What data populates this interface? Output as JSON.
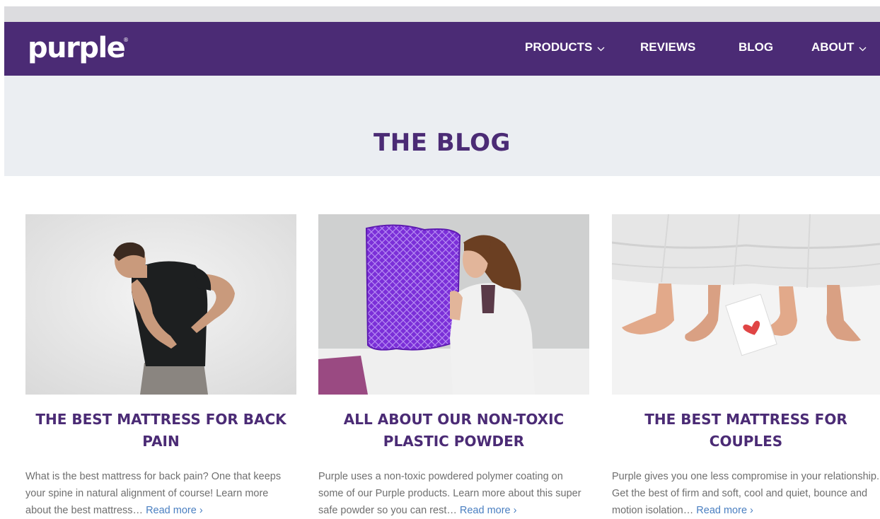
{
  "header": {
    "logo_text": "purple",
    "logo_mark": "®",
    "nav": [
      {
        "label": "PRODUCTS",
        "dropdown": true
      },
      {
        "label": "REVIEWS",
        "dropdown": false
      },
      {
        "label": "BLOG",
        "dropdown": false
      },
      {
        "label": "ABOUT",
        "dropdown": true
      }
    ]
  },
  "hero": {
    "title": "THE BLOG"
  },
  "posts": [
    {
      "title": "THE BEST MATTRESS FOR BACK PAIN",
      "excerpt": "What is the best mattress for back pain? One that keeps your spine in natural alignment of course! Learn more about the best mattress…",
      "read_more": "Read more ›"
    },
    {
      "title": "ALL ABOUT OUR NON-TOXIC PLASTIC POWDER",
      "excerpt": "Purple uses a non-toxic powdered polymer coating on some of our Purple products. Learn more about this super safe powder so you can rest…",
      "read_more": "Read more ›"
    },
    {
      "title": "THE BEST MATTRESS FOR COUPLES",
      "excerpt": "Purple gives you one less compromise in your relationship. Get the best of firm and soft, cool and quiet, bounce and motion isolation…",
      "read_more": "Read more ›"
    }
  ],
  "colors": {
    "brand_purple": "#4b2b75",
    "hero_bg": "#ebeef2",
    "link_blue": "#4a7fc1",
    "body_text": "#6f6f6f"
  }
}
